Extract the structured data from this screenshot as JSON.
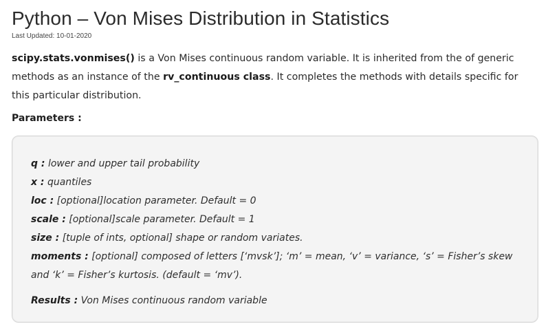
{
  "article": {
    "title": "Python – Von Mises Distribution in Statistics",
    "last_updated": "Last Updated: 10-01-2020",
    "intro": {
      "func_name": "scipy.stats.vonmises()",
      "text_1": " is a Von Mises continuous random variable. It is inherited from the of generic methods as an instance of the ",
      "class_name": "rv_continuous class",
      "text_2": ". It completes the methods with details specific for this particular distribution."
    },
    "parameters_heading": "Parameters :",
    "parameters": [
      {
        "name": "q :",
        "desc": " lower and upper tail probability"
      },
      {
        "name": "x :",
        "desc": " quantiles"
      },
      {
        "name": "loc :",
        "desc": " [optional]location parameter. Default = 0"
      },
      {
        "name": "scale :",
        "desc": " [optional]scale parameter. Default = 1"
      },
      {
        "name": "size :",
        "desc": " [tuple of ints, optional] shape or random variates."
      },
      {
        "name": "moments :",
        "desc": " [optional] composed of letters [‘mvsk’]; ‘m’ = mean, ‘v’ = variance, ‘s’ = Fisher’s skew and ‘k’ = Fisher’s kurtosis. (default = ‘mv’)."
      }
    ],
    "results": {
      "name": "Results :",
      "desc": " Von Mises continuous random variable"
    }
  }
}
